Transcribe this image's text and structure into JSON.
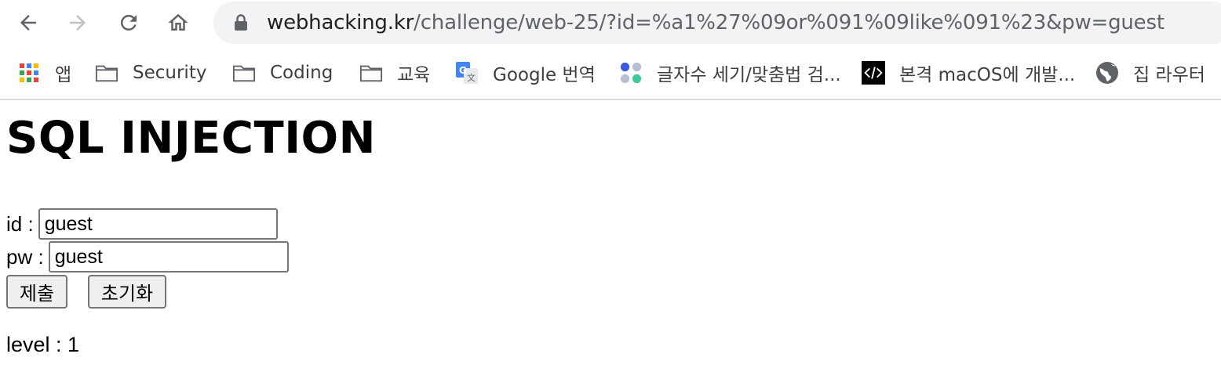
{
  "browser": {
    "url_host": "webhacking.kr",
    "url_path": "/challenge/web-25/?id=%a1%27%09or%091%09like%091%23&pw=guest",
    "bookmarks": [
      {
        "label": "앱",
        "icon": "apps-grid-icon"
      },
      {
        "label": "Security",
        "icon": "folder-icon"
      },
      {
        "label": "Coding",
        "icon": "folder-icon"
      },
      {
        "label": "교육",
        "icon": "folder-icon"
      },
      {
        "label": "Google 번역",
        "icon": "google-translate-icon"
      },
      {
        "label": "글자수 세기/맞춤법 검...",
        "icon": "dots-icon"
      },
      {
        "label": "본격 macOS에 개발...",
        "icon": "code-icon"
      },
      {
        "label": "집 라우터",
        "icon": "globe-icon"
      }
    ]
  },
  "page": {
    "title": "SQL INJECTION",
    "id_label": "id :",
    "id_value": "guest",
    "pw_label": "pw :",
    "pw_value": "guest",
    "submit_label": "제출",
    "reset_label": "초기화",
    "level_text": "level : 1"
  },
  "colors": {
    "omnibox_bg": "#f1f3f4",
    "button_bg": "#efefef",
    "icon_gray": "#5f6368"
  }
}
